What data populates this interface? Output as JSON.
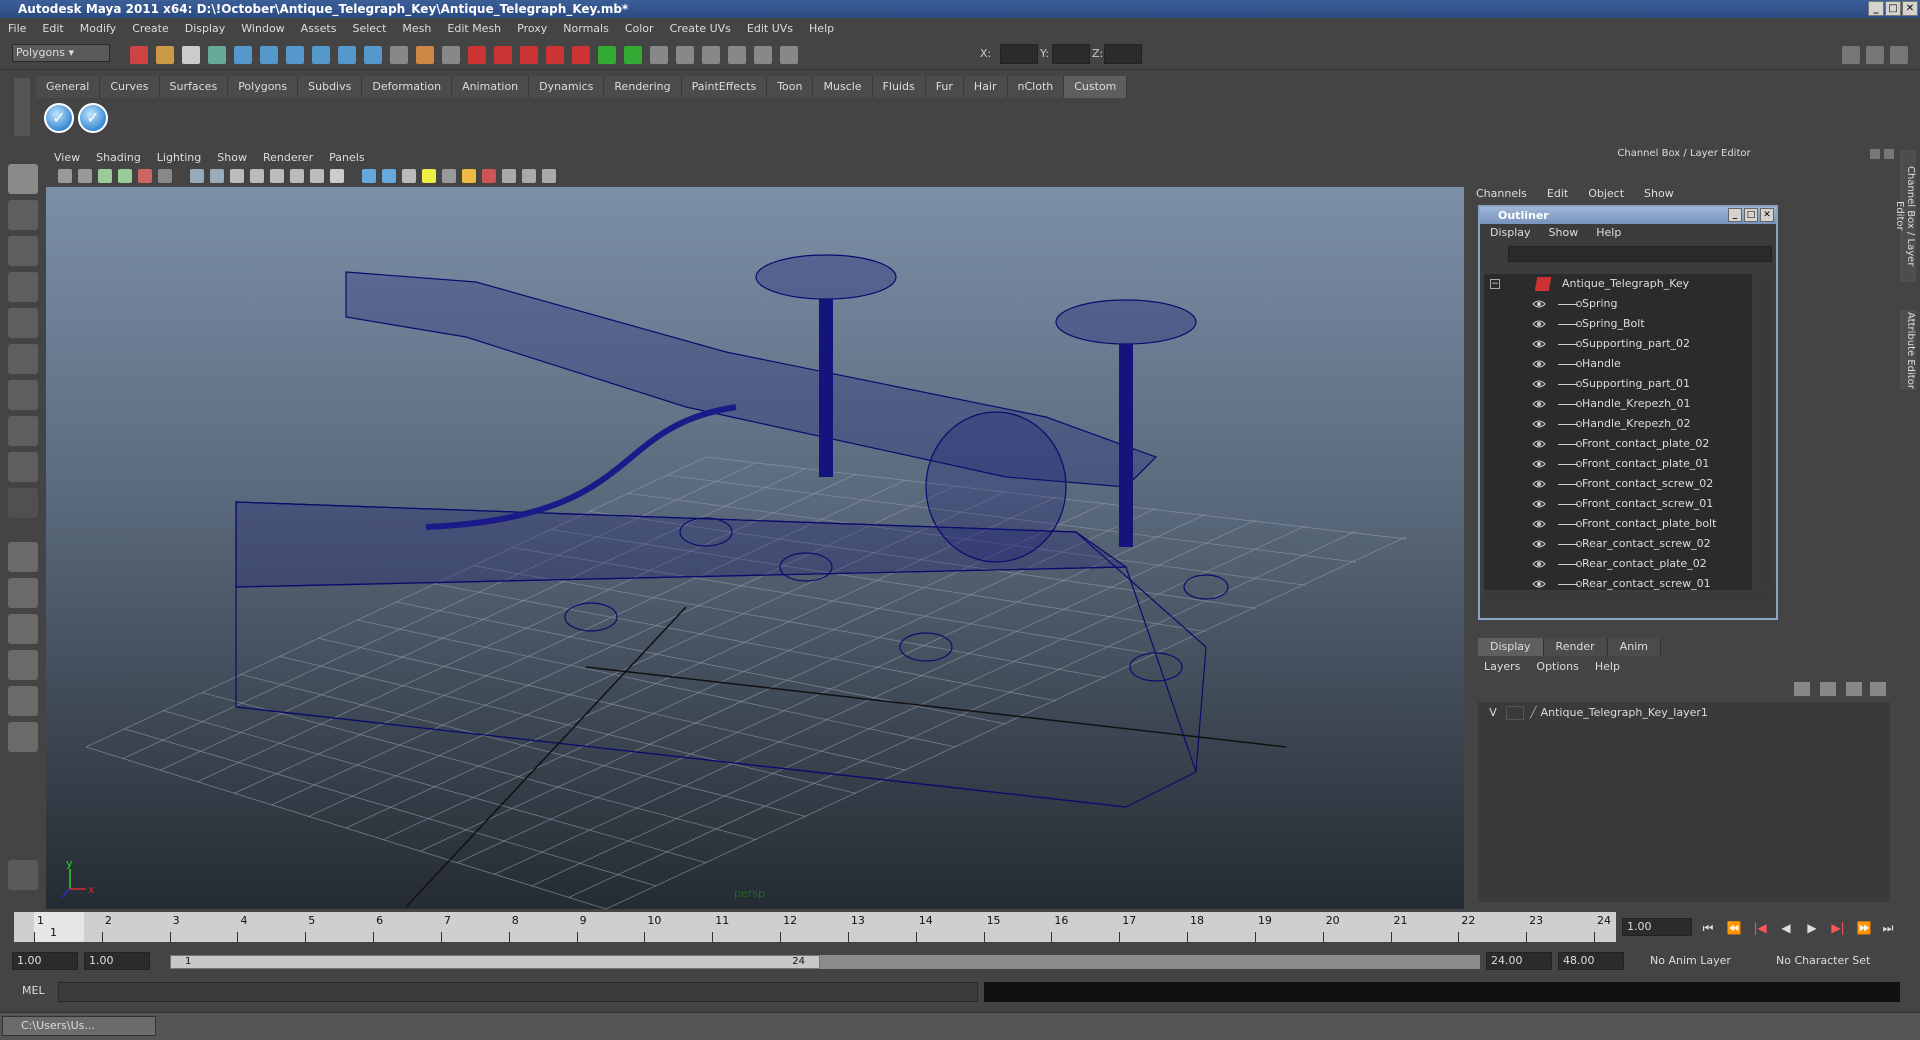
{
  "window": {
    "title": "Autodesk Maya 2011 x64: D:\\!October\\Antique_Telegraph_Key\\Antique_Telegraph_Key.mb*"
  },
  "menubar": [
    "File",
    "Edit",
    "Modify",
    "Create",
    "Display",
    "Window",
    "Assets",
    "Select",
    "Mesh",
    "Edit Mesh",
    "Proxy",
    "Normals",
    "Color",
    "Create UVs",
    "Edit UVs",
    "Help"
  ],
  "statusline": {
    "mode": "Polygons",
    "coord_labels": [
      "X:",
      "Y:",
      "Z:"
    ]
  },
  "shelf": {
    "tabs": [
      "General",
      "Curves",
      "Surfaces",
      "Polygons",
      "Subdivs",
      "Deformation",
      "Animation",
      "Dynamics",
      "Rendering",
      "PaintEffects",
      "Toon",
      "Muscle",
      "Fluids",
      "Fur",
      "Hair",
      "nCloth",
      "Custom"
    ],
    "active_tab": "Custom"
  },
  "viewport": {
    "menu": [
      "View",
      "Shading",
      "Lighting",
      "Show",
      "Renderer",
      "Panels"
    ],
    "camera_label": "persp",
    "axis_labels": {
      "y": "y",
      "x": "x"
    }
  },
  "channel_box": {
    "title": "Channel Box / Layer Editor",
    "menu": [
      "Channels",
      "Edit",
      "Object",
      "Show"
    ]
  },
  "outliner": {
    "title": "Outliner",
    "menu": [
      "Display",
      "Show",
      "Help"
    ],
    "root": "Antique_Telegraph_Key",
    "items": [
      "Spring",
      "Spring_Bolt",
      "Supporting_part_02",
      "Handle",
      "Supporting_part_01",
      "Handle_Krepezh_01",
      "Handle_Krepezh_02",
      "Front_contact_plate_02",
      "Front_contact_plate_01",
      "Front_contact_screw_02",
      "Front_contact_screw_01",
      "Front_contact_plate_bolt",
      "Rear_contact_screw_02",
      "Rear_contact_plate_02",
      "Rear_contact_screw_01"
    ]
  },
  "layer_editor": {
    "tabs": [
      "Display",
      "Render",
      "Anim"
    ],
    "active_tab": "Display",
    "menu": [
      "Layers",
      "Options",
      "Help"
    ],
    "layers": [
      {
        "visible": "V",
        "name": "Antique_Telegraph_Key_layer1"
      }
    ]
  },
  "side_tabs": [
    "Channel Box / Layer Editor",
    "Attribute Editor"
  ],
  "timeslider": {
    "ticks": [
      "1",
      "2",
      "3",
      "4",
      "5",
      "6",
      "7",
      "8",
      "9",
      "10",
      "11",
      "12",
      "13",
      "14",
      "15",
      "16",
      "17",
      "18",
      "19",
      "20",
      "21",
      "22",
      "23",
      "24"
    ],
    "current_frame": "1",
    "playback_field": "1.00"
  },
  "rangeslider": {
    "start": "1.00",
    "start2": "1.00",
    "handle_start": "1",
    "handle_end": "24",
    "end": "24.00",
    "end2": "48.00",
    "anim_layer": "No Anim Layer",
    "character_set": "No Character Set"
  },
  "cmdline": {
    "label": "MEL"
  },
  "taskbar": {
    "item": "C:\\Users\\Us..."
  },
  "colors": {
    "wireframe": "#0b0b6e",
    "accent": "#3a8ad4"
  }
}
